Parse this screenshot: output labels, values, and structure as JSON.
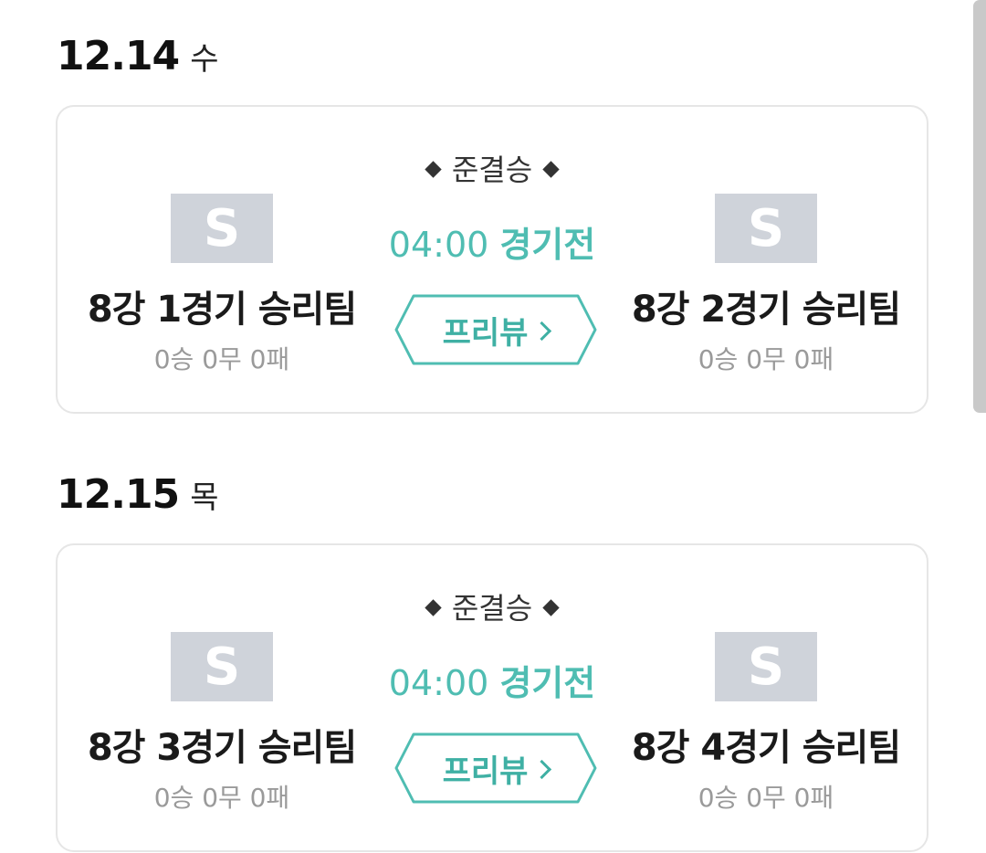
{
  "days": [
    {
      "date": "12.14",
      "weekday": "수",
      "match": {
        "round": "준결승",
        "time": "04:00",
        "status": "경기전",
        "preview_label": "프리뷰",
        "home": {
          "logo": "S",
          "name": "8강 1경기 승리팀",
          "record": "0승 0무 0패"
        },
        "away": {
          "logo": "S",
          "name": "8강 2경기 승리팀",
          "record": "0승 0무 0패"
        }
      }
    },
    {
      "date": "12.15",
      "weekday": "목",
      "match": {
        "round": "준결승",
        "time": "04:00",
        "status": "경기전",
        "preview_label": "프리뷰",
        "home": {
          "logo": "S",
          "name": "8강 3경기 승리팀",
          "record": "0승 0무 0패"
        },
        "away": {
          "logo": "S",
          "name": "8강 4경기 승리팀",
          "record": "0승 0무 0패"
        }
      }
    }
  ],
  "colors": {
    "accent": "#4fbdb2",
    "logo_bg": "#cfd3da",
    "record": "#9a9a9a",
    "card_border": "#e6e6e6"
  }
}
